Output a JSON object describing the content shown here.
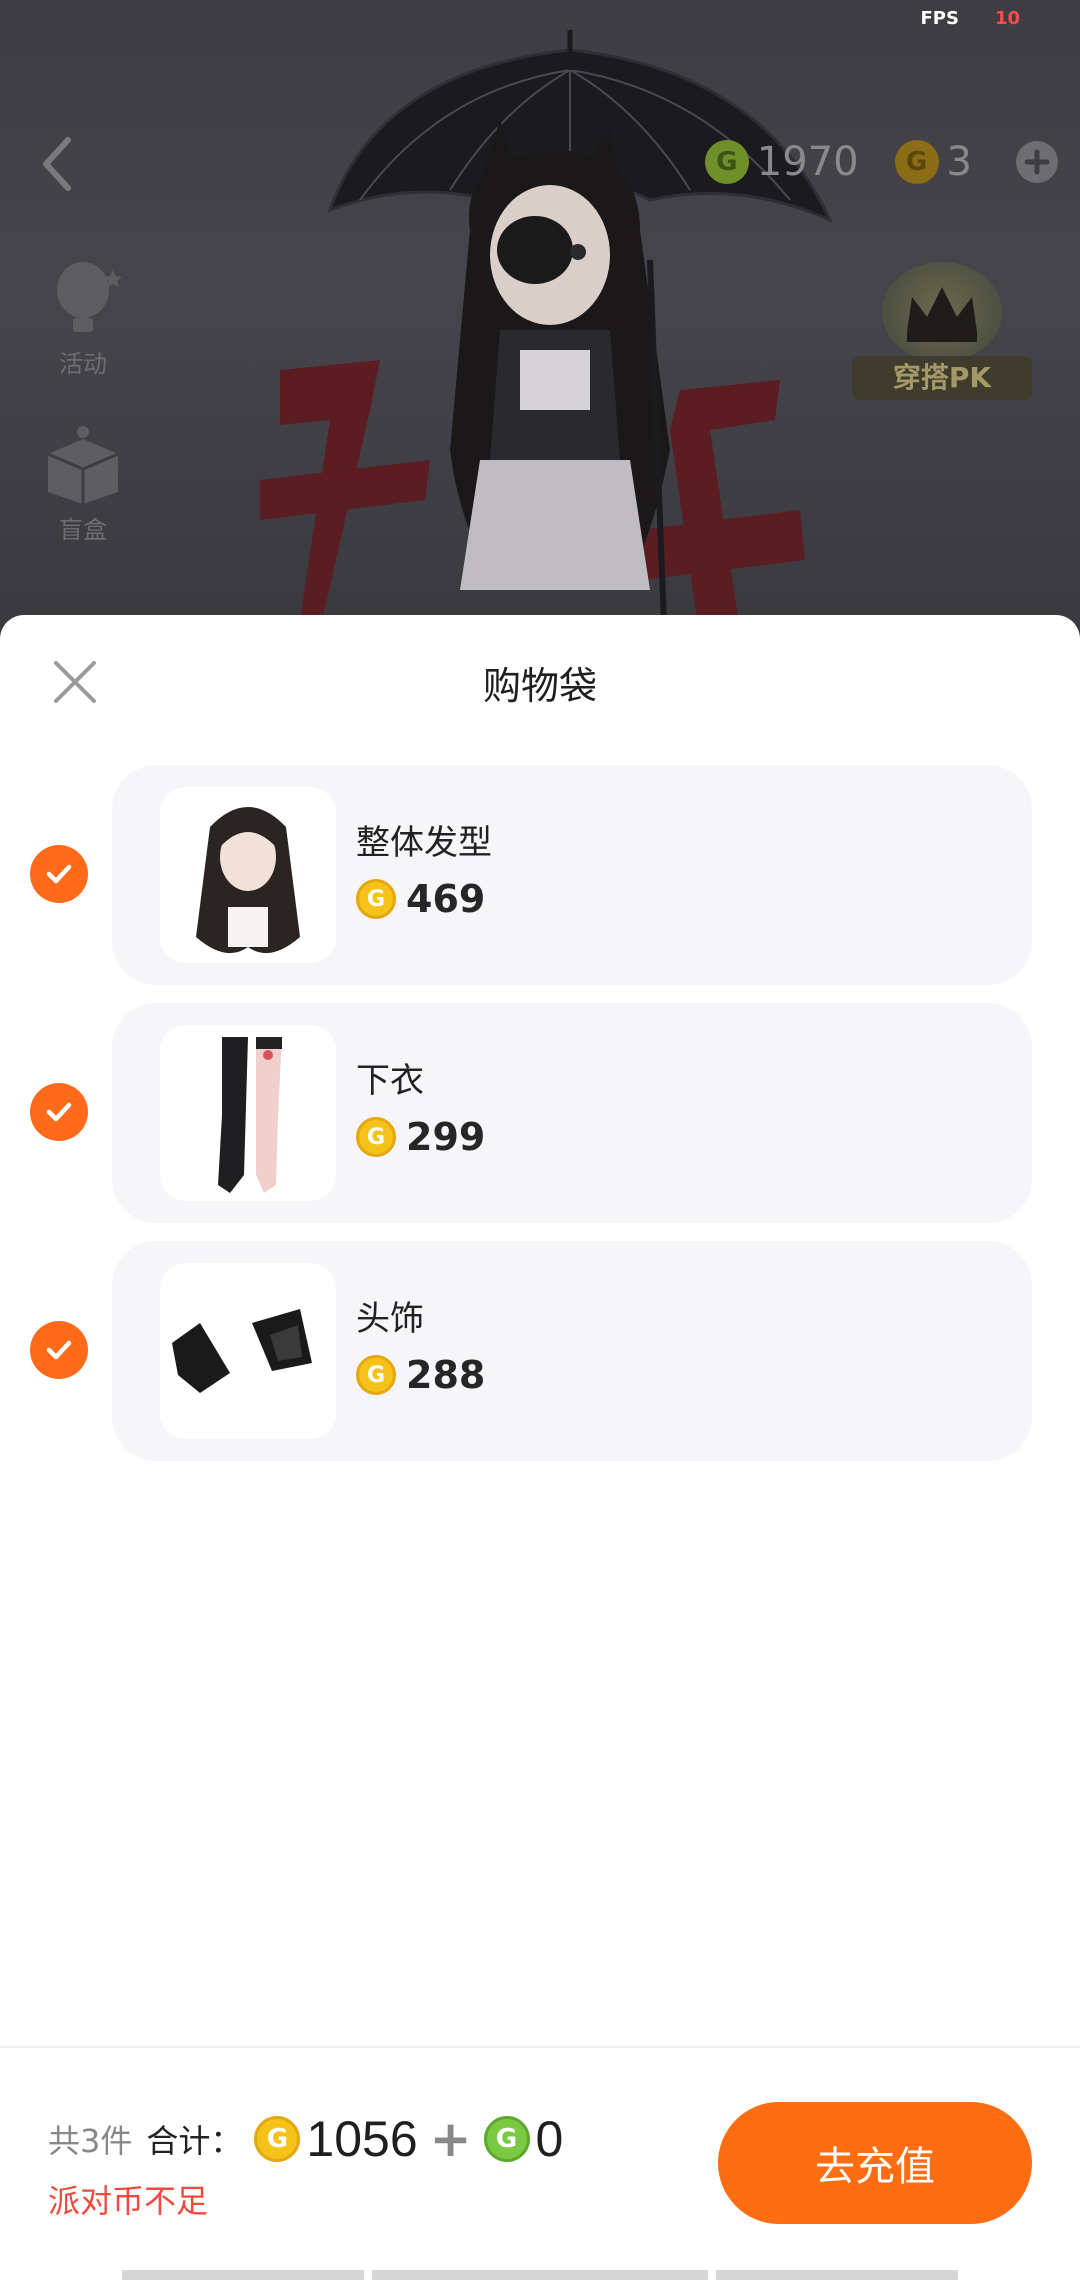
{
  "status": {
    "fps_label": "FPS",
    "fps_value": "10"
  },
  "topbar": {
    "green_currency": "1970",
    "gold_currency": "3",
    "back_icon": "chevron-left-icon",
    "add_icon": "plus-circle-icon"
  },
  "side_menu": [
    {
      "label": "活动",
      "icon": "hot-air-balloon-icon"
    },
    {
      "label": "盲盒",
      "icon": "blind-box-icon"
    }
  ],
  "pk_badge": {
    "label": "穿搭PK",
    "icon": "crown-icon"
  },
  "sheet": {
    "title": "购物袋",
    "close_icon": "close-icon",
    "items": [
      {
        "name": "整体发型",
        "price": "469",
        "checked": true,
        "thumb_icon": "hairstyle-thumbnail"
      },
      {
        "name": "下衣",
        "price": "299",
        "checked": true,
        "thumb_icon": "stockings-thumbnail"
      },
      {
        "name": "头饰",
        "price": "288",
        "checked": true,
        "thumb_icon": "cat-ears-thumbnail"
      }
    ]
  },
  "footer": {
    "count_text": "共3件",
    "total_label": "合计：",
    "gold_total": "1056",
    "plus": "+",
    "green_total": "0",
    "warning": "派对币不足",
    "recharge_label": "去充值"
  },
  "colors": {
    "accent": "#ff6d12",
    "check": "#ff6b1a",
    "warning": "#f04a3e",
    "gold_coin": "#f5c21a",
    "green_coin": "#7ac943"
  }
}
